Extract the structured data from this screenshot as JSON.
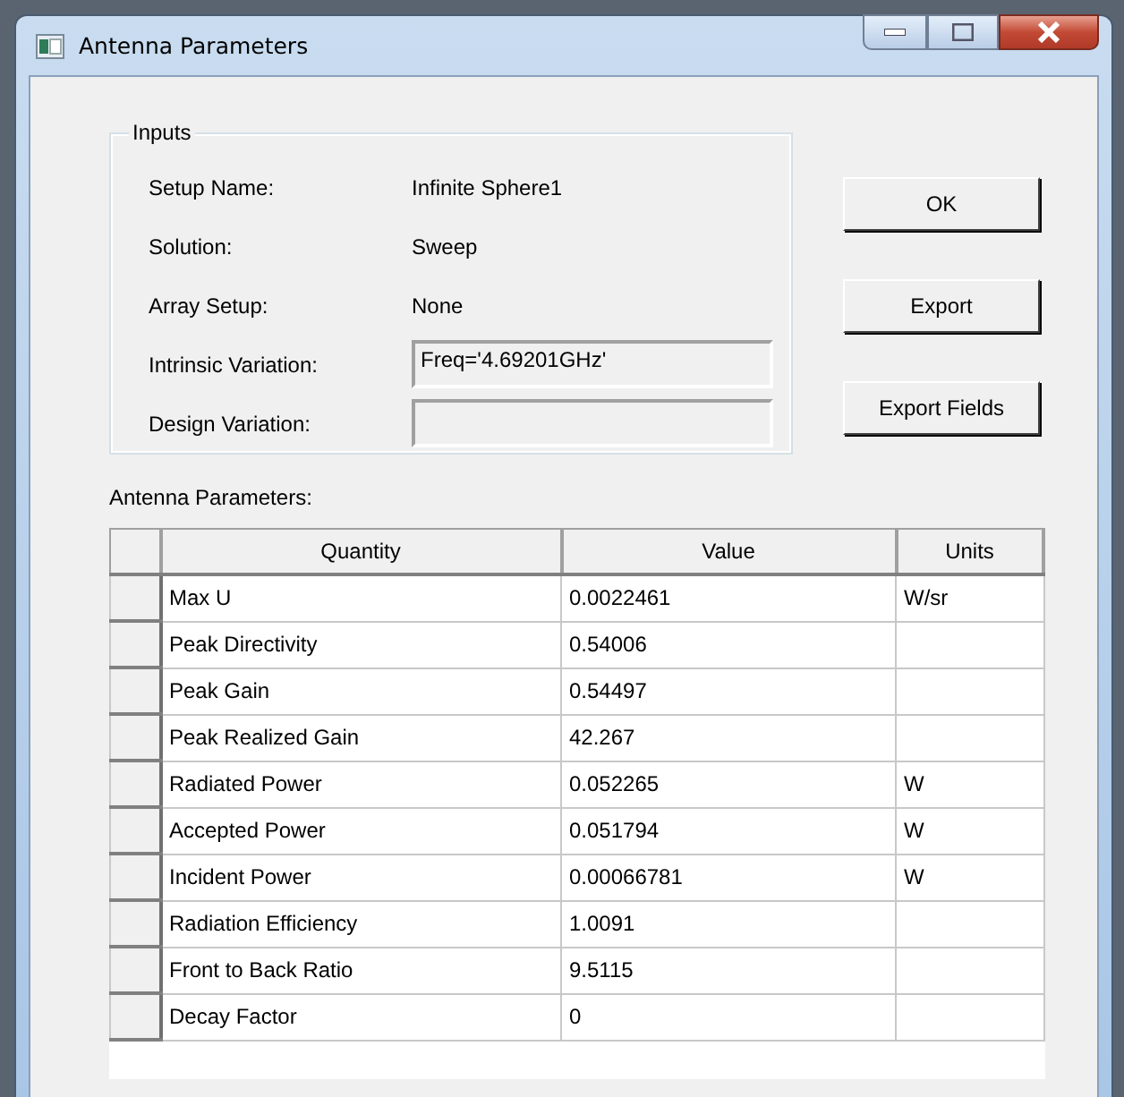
{
  "window": {
    "title": "Antenna Parameters"
  },
  "inputs": {
    "title": "Inputs",
    "rows": [
      {
        "label": "Setup Name:",
        "kind": "text",
        "value": "Infinite Sphere1"
      },
      {
        "label": "Solution:",
        "kind": "text",
        "value": "Sweep"
      },
      {
        "label": "Array Setup:",
        "kind": "text",
        "value": "None"
      },
      {
        "label": "Intrinsic Variation:",
        "kind": "field",
        "value": "Freq='4.69201GHz'"
      },
      {
        "label": "Design Variation:",
        "kind": "field"
      }
    ]
  },
  "buttons": [
    "OK",
    "Export",
    "Export Fields"
  ],
  "table": {
    "label": "Antenna Parameters:",
    "columns": [
      "Quantity",
      "Value",
      "Units"
    ],
    "rows": [
      {
        "quantity": "Max U",
        "value": "0.0022461",
        "units": "W/sr"
      },
      {
        "quantity": "Peak Directivity",
        "value": "0.54006"
      },
      {
        "quantity": "Peak Gain",
        "value": "0.54497"
      },
      {
        "quantity": "Peak Realized Gain",
        "value": "42.267"
      },
      {
        "quantity": "Radiated Power",
        "value": "0.052265",
        "units": "W"
      },
      {
        "quantity": "Accepted Power",
        "value": "0.051794",
        "units": "W"
      },
      {
        "quantity": "Incident Power",
        "value": "0.00066781",
        "units": "W"
      },
      {
        "quantity": "Radiation Efficiency",
        "value": "1.0091"
      },
      {
        "quantity": "Front to Back Ratio",
        "value": "9.5115"
      },
      {
        "quantity": "Decay Factor",
        "value": "0"
      }
    ]
  }
}
